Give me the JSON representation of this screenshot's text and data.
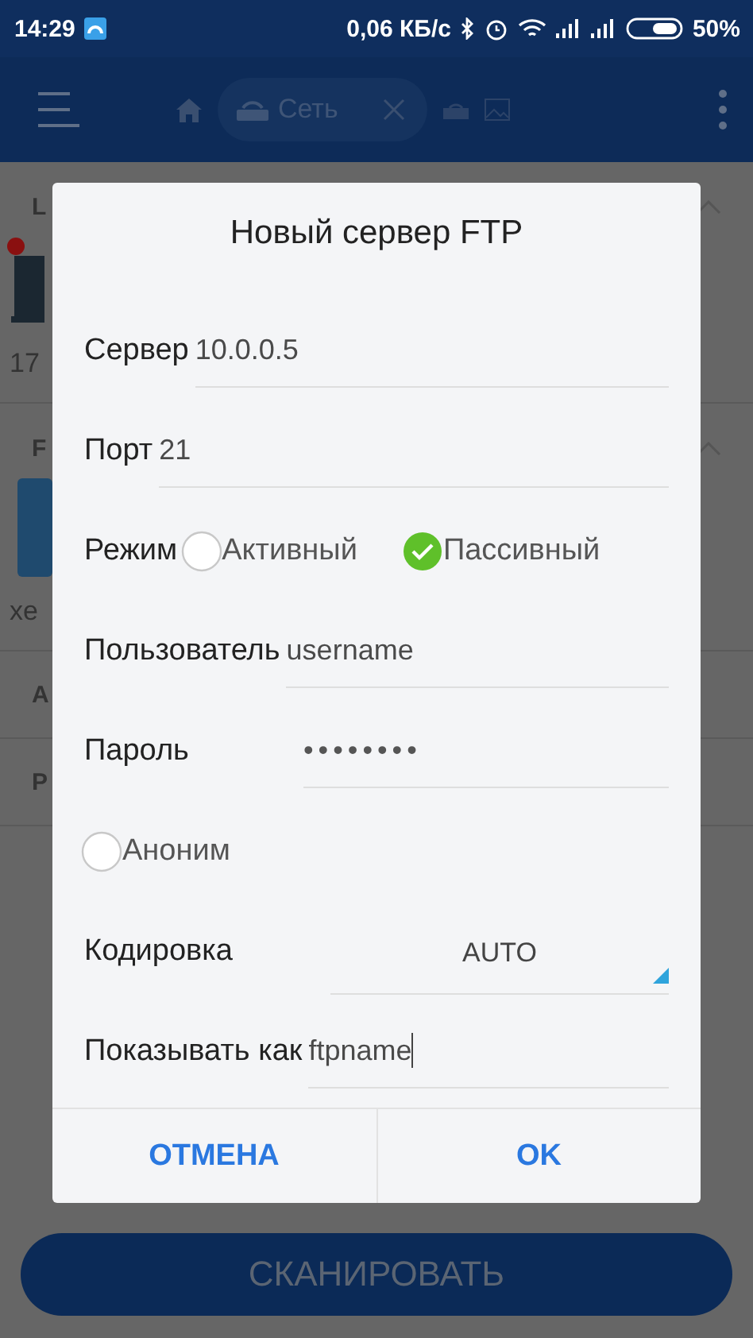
{
  "status_bar": {
    "time": "14:29",
    "speed": "0,06 КБ/с",
    "battery": "50%"
  },
  "toolbar": {
    "tab": {
      "label": "Сеть"
    }
  },
  "background": {
    "sections": [
      {
        "label": "L",
        "kind": "device",
        "caption": "17"
      },
      {
        "label": "F",
        "kind": "tile",
        "caption": "xe"
      }
    ],
    "rows": [
      "A",
      "P"
    ],
    "scan_button": "СКАНИРОВАТЬ"
  },
  "dialog": {
    "title": "Новый сервер FTP",
    "fields": [
      {
        "kind": "text",
        "label": "Сервер",
        "value": "10.0.0.5"
      },
      {
        "kind": "text",
        "label": "Порт",
        "value": "21"
      },
      {
        "kind": "radio",
        "label": "Режим",
        "options": [
          {
            "label": "Активный",
            "selected": false
          },
          {
            "label": "Пассивный",
            "selected": true
          }
        ]
      },
      {
        "kind": "text",
        "label": "Пользователь",
        "value": "username"
      },
      {
        "kind": "password",
        "label": "Пароль",
        "value": "••••••••"
      },
      {
        "kind": "check",
        "label": "Аноним",
        "checked": false
      },
      {
        "kind": "select",
        "label": "Кодировка",
        "value": "AUTO"
      },
      {
        "kind": "text",
        "label": "Показывать как",
        "value": "ftpname",
        "focused": true
      }
    ],
    "buttons": [
      "ОТМЕНА",
      "OK"
    ]
  }
}
